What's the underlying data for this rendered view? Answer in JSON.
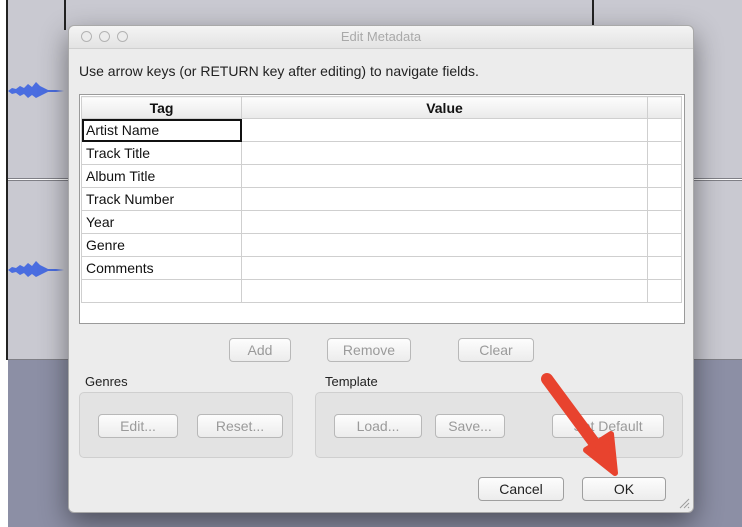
{
  "dialog": {
    "title": "Edit Metadata",
    "instructions": "Use arrow keys (or RETURN key after editing) to navigate fields."
  },
  "table": {
    "headers": [
      "Tag",
      "Value"
    ],
    "rows": [
      {
        "tag": "Artist Name",
        "value": ""
      },
      {
        "tag": "Track Title",
        "value": ""
      },
      {
        "tag": "Album Title",
        "value": ""
      },
      {
        "tag": "Track Number",
        "value": ""
      },
      {
        "tag": "Year",
        "value": ""
      },
      {
        "tag": "Genre",
        "value": ""
      },
      {
        "tag": "Comments",
        "value": ""
      },
      {
        "tag": "",
        "value": ""
      }
    ]
  },
  "actions": {
    "add": "Add",
    "remove": "Remove",
    "clear": "Clear"
  },
  "genres": {
    "label": "Genres",
    "edit": "Edit...",
    "reset": "Reset..."
  },
  "template": {
    "label": "Template",
    "load": "Load...",
    "save": "Save...",
    "set_default": "Set Default"
  },
  "footer": {
    "cancel": "Cancel",
    "ok": "OK"
  },
  "colors": {
    "annotation_arrow": "#e8432e",
    "waveform": "#4a6de0"
  }
}
